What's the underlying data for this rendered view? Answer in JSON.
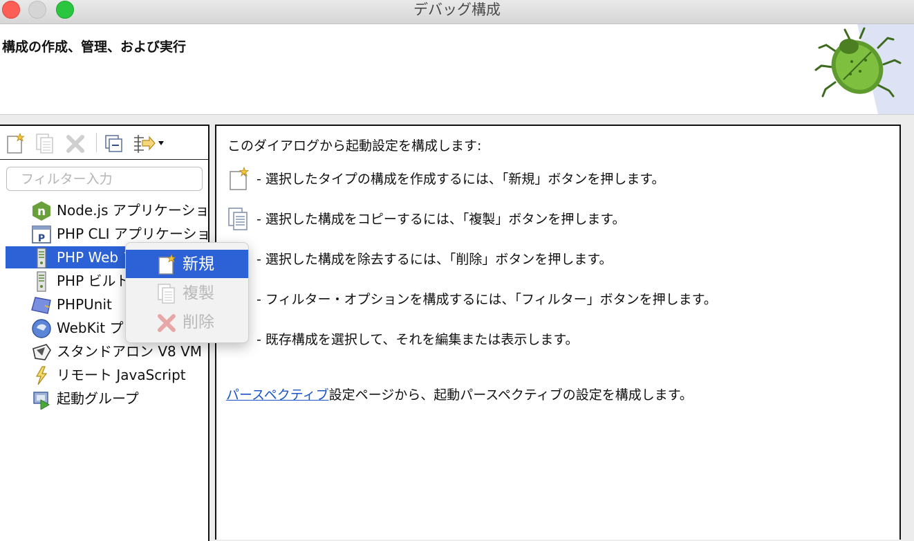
{
  "window": {
    "title": "デバッグ構成"
  },
  "header": {
    "title": "構成の作成、管理、および実行"
  },
  "filter": {
    "placeholder": "フィルター入力",
    "value": ""
  },
  "tree": {
    "items": [
      {
        "label": "Node.js アプリケーション",
        "icon": "nodejs-icon"
      },
      {
        "label": "PHP CLI アプリケーション",
        "icon": "php-cli-icon"
      },
      {
        "label": "PHP Web アプリケーション",
        "icon": "php-web-icon",
        "selected": true
      },
      {
        "label": "PHP ビルトインサーバー",
        "icon": "php-builtin-icon"
      },
      {
        "label": "PHPUnit",
        "icon": "phpunit-icon"
      },
      {
        "label": "WebKit プロトコル",
        "icon": "webkit-icon"
      },
      {
        "label": "スタンドアロン V8 VM",
        "icon": "v8-icon"
      },
      {
        "label": "リモート JavaScript",
        "icon": "remote-js-icon"
      },
      {
        "label": "起動グループ",
        "icon": "launch-group-icon"
      }
    ]
  },
  "context_menu": {
    "items": [
      {
        "label": "新規",
        "icon": "new-config-icon",
        "state": "highlighted"
      },
      {
        "label": "複製",
        "icon": "duplicate-icon",
        "state": "disabled"
      },
      {
        "label": "削除",
        "icon": "delete-icon",
        "state": "disabled"
      }
    ]
  },
  "main": {
    "intro": "このダイアログから起動設定を構成します:",
    "tips": [
      {
        "text": "- 選択したタイプの構成を作成するには、「新規」ボタンを押します。",
        "icon": "new-config-icon"
      },
      {
        "text": "- 選択した構成をコピーするには、「複製」ボタンを押します。",
        "icon": "duplicate-icon"
      },
      {
        "text": "- 選択した構成を除去するには、「削除」ボタンを押します。",
        "icon": "delete-icon"
      },
      {
        "text": "- フィルター・オプションを構成するには、「フィルター」ボタンを押します。",
        "icon": "filter-icon"
      },
      {
        "text": "- 既存構成を選択して、それを編集または表示します。",
        "icon": "edit-icon"
      }
    ],
    "perspective_link": "パースペクティブ",
    "perspective_text": "設定ページから、起動パースペクティブの設定を構成します。"
  },
  "colors": {
    "selection": "#2c62d6",
    "link": "#1a55c8",
    "close": "#fd5f57",
    "maximize": "#2ac640"
  }
}
